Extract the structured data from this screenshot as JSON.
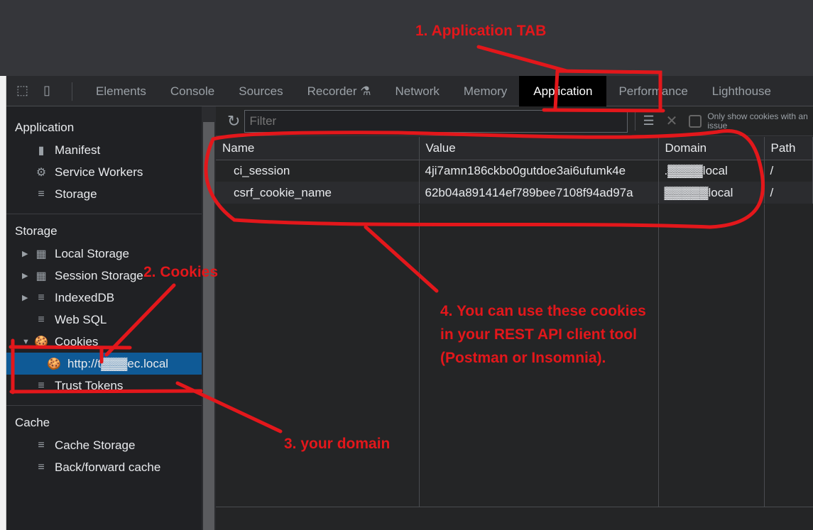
{
  "devtools": {
    "tabs": [
      "Elements",
      "Console",
      "Sources",
      "Recorder",
      "Network",
      "Memory",
      "Application",
      "Performance",
      "Lighthouse"
    ],
    "active_tab": "Application",
    "sidebar": {
      "application_header": "Application",
      "application_items": [
        "Manifest",
        "Service Workers",
        "Storage"
      ],
      "storage_header": "Storage",
      "storage_items": [
        "Local Storage",
        "Session Storage",
        "IndexedDB",
        "Web SQL",
        "Cookies"
      ],
      "cookie_origin": "http://t▓▓▓ec.local",
      "trust_tokens": "Trust Tokens",
      "cache_header": "Cache",
      "cache_items": [
        "Cache Storage",
        "Back/forward cache"
      ]
    },
    "toolbar": {
      "filter_placeholder": "Filter",
      "only_show_label": "Only show cookies with an issue"
    },
    "table": {
      "columns": [
        "Name",
        "Value",
        "Domain",
        "Path"
      ],
      "rows": [
        {
          "name": "ci_session",
          "value": "4ji7amn186ckbo0gutdoe3ai6ufumk4e",
          "domain": ".▓▓▓▓local",
          "path": "/"
        },
        {
          "name": "csrf_cookie_name",
          "value": "62b04a891414ef789bee7108f94ad97a",
          "domain": "▓▓▓▓▓local",
          "path": "/"
        }
      ]
    }
  },
  "annotations": {
    "a1": "1. Application",
    "a1b": "TAB",
    "a2": "2. Cookies",
    "a3": "3. your domain",
    "a4": "4. You can use these cookies in your REST API client tool (Postman or Insomnia).",
    "color": "#e3171b"
  }
}
